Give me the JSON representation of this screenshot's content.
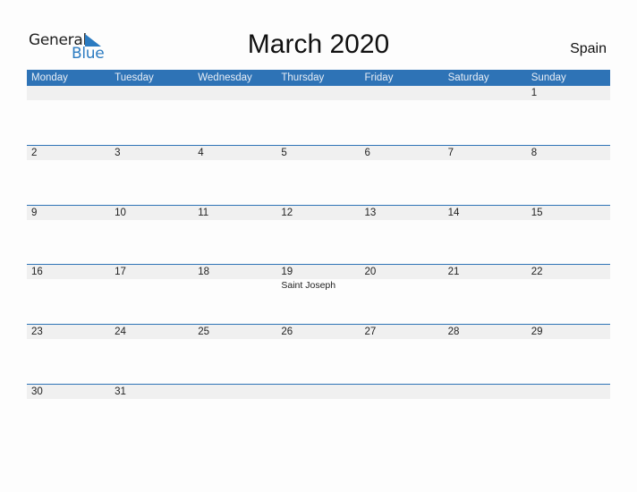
{
  "logo": {
    "word1": "General",
    "word2": "Blue",
    "icon": "triangle-flag-icon",
    "accent": "#2b7bc1"
  },
  "title": "March 2020",
  "country": "Spain",
  "header_color": "#2e73b6",
  "days_of_week": [
    "Monday",
    "Tuesday",
    "Wednesday",
    "Thursday",
    "Friday",
    "Saturday",
    "Sunday"
  ],
  "weeks": [
    [
      {
        "day": ""
      },
      {
        "day": ""
      },
      {
        "day": ""
      },
      {
        "day": ""
      },
      {
        "day": ""
      },
      {
        "day": ""
      },
      {
        "day": "1"
      }
    ],
    [
      {
        "day": "2"
      },
      {
        "day": "3"
      },
      {
        "day": "4"
      },
      {
        "day": "5"
      },
      {
        "day": "6"
      },
      {
        "day": "7"
      },
      {
        "day": "8"
      }
    ],
    [
      {
        "day": "9"
      },
      {
        "day": "10"
      },
      {
        "day": "11"
      },
      {
        "day": "12"
      },
      {
        "day": "13"
      },
      {
        "day": "14"
      },
      {
        "day": "15"
      }
    ],
    [
      {
        "day": "16"
      },
      {
        "day": "17"
      },
      {
        "day": "18"
      },
      {
        "day": "19",
        "event": "Saint Joseph"
      },
      {
        "day": "20"
      },
      {
        "day": "21"
      },
      {
        "day": "22"
      }
    ],
    [
      {
        "day": "23"
      },
      {
        "day": "24"
      },
      {
        "day": "25"
      },
      {
        "day": "26"
      },
      {
        "day": "27"
      },
      {
        "day": "28"
      },
      {
        "day": "29"
      }
    ],
    [
      {
        "day": "30"
      },
      {
        "day": "31"
      },
      {
        "day": ""
      },
      {
        "day": ""
      },
      {
        "day": ""
      },
      {
        "day": ""
      },
      {
        "day": ""
      }
    ]
  ]
}
